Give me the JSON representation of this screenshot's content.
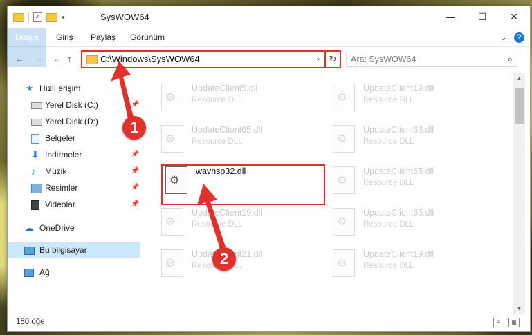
{
  "window": {
    "title": "SysWOW64",
    "minimize": "—",
    "maximize": "☐",
    "close": "✕"
  },
  "ribbon": {
    "tabs": [
      "Dosya",
      "Giriş",
      "Paylaş",
      "Görünüm"
    ],
    "expand": "⌄",
    "help": "?"
  },
  "nav": {
    "back": "←",
    "forward": "→",
    "recent": "⌄",
    "up": "↑",
    "address": "C:\\Windows\\SysWOW64",
    "refresh": "↻",
    "search_placeholder": "Ara: SysWOW64",
    "search_icon": "⌕"
  },
  "sidebar": {
    "items": [
      {
        "label": "Hızlı erişim",
        "icon": "star-icon"
      },
      {
        "label": "Yerel Disk (C:)",
        "icon": "drive-icon"
      },
      {
        "label": "Yerel Disk (D:)",
        "icon": "drive-icon"
      },
      {
        "label": "Belgeler",
        "icon": "documents-icon"
      },
      {
        "label": "İndirmeler",
        "icon": "download-icon"
      },
      {
        "label": "Müzik",
        "icon": "music-icon"
      },
      {
        "label": "Resimler",
        "icon": "pictures-icon"
      },
      {
        "label": "Videolar",
        "icon": "videos-icon"
      },
      {
        "label": "OneDrive",
        "icon": "cloud-icon"
      },
      {
        "label": "Bu bilgisayar",
        "icon": "computer-icon"
      },
      {
        "label": "Ağ",
        "icon": "network-icon"
      }
    ],
    "pin": "📌"
  },
  "files": [
    {
      "name": "UpdateClient5.dll",
      "type": "Resource DLL"
    },
    {
      "name": "UpdateClient19.dll",
      "type": "Resource DLL"
    },
    {
      "name": "UpdateClient65.dll",
      "type": "Resource DLL"
    },
    {
      "name": "UpdateClient63.dll",
      "type": "Resource DLL"
    },
    {
      "name": "wavhsp32.dll",
      "type": ""
    },
    {
      "name": "UpdateClient65.dll",
      "type": "Resource DLL"
    },
    {
      "name": "UpdateClient19.dll",
      "type": "Resource DLL"
    },
    {
      "name": "UpdateClient65.dll",
      "type": "Resource DLL"
    },
    {
      "name": "UpdateClient21.dll",
      "type": "Resource DLL"
    },
    {
      "name": "UpdateClient19.dll",
      "type": "Resource DLL"
    }
  ],
  "status": {
    "count": "180 öğe"
  },
  "callouts": [
    "1",
    "2"
  ],
  "colors": {
    "accent": "#1979ca",
    "highlight": "#e0312d",
    "selected": "#cce8ff"
  }
}
